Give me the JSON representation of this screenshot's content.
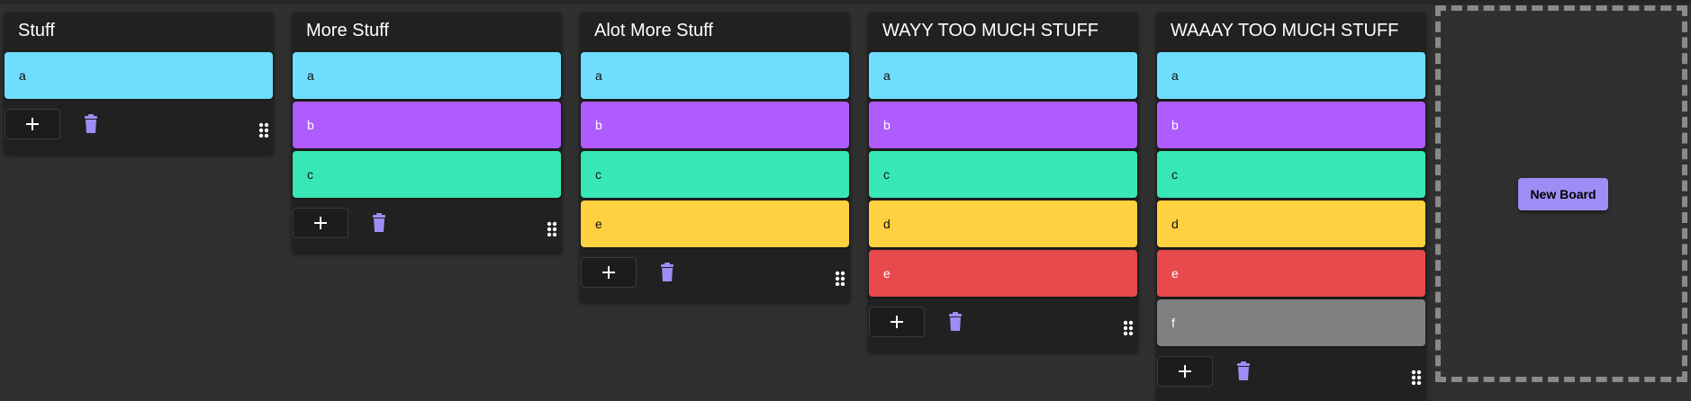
{
  "colors": {
    "background": "#303030",
    "board": "#212121",
    "accent": "#a08cf5",
    "card_colors": {
      "cyan": "#6fdefe",
      "purple": "#ae5cfd",
      "green": "#38e7b6",
      "yellow": "#ffd03f",
      "red": "#e64a4d",
      "gray": "#808080"
    }
  },
  "icons": {
    "add": "plus-icon",
    "delete": "trash-icon",
    "drag": "drag-handle-icon"
  },
  "boards": [
    {
      "title": "Stuff",
      "cards": [
        {
          "label": "a",
          "color": "#6fdefe",
          "text_color": "#111111"
        }
      ]
    },
    {
      "title": "More Stuff",
      "cards": [
        {
          "label": "a",
          "color": "#6fdefe",
          "text_color": "#111111"
        },
        {
          "label": "b",
          "color": "#ae5cfd",
          "text_color": "#ffffff"
        },
        {
          "label": "c",
          "color": "#38e7b6",
          "text_color": "#111111"
        }
      ]
    },
    {
      "title": "Alot More Stuff",
      "cards": [
        {
          "label": "a",
          "color": "#6fdefe",
          "text_color": "#111111"
        },
        {
          "label": "b",
          "color": "#ae5cfd",
          "text_color": "#ffffff"
        },
        {
          "label": "c",
          "color": "#38e7b6",
          "text_color": "#111111"
        },
        {
          "label": "e",
          "color": "#ffd03f",
          "text_color": "#111111"
        }
      ]
    },
    {
      "title": "WAYY TOO MUCH STUFF",
      "cards": [
        {
          "label": "a",
          "color": "#6fdefe",
          "text_color": "#111111"
        },
        {
          "label": "b",
          "color": "#ae5cfd",
          "text_color": "#ffffff"
        },
        {
          "label": "c",
          "color": "#38e7b6",
          "text_color": "#111111"
        },
        {
          "label": "d",
          "color": "#ffd03f",
          "text_color": "#111111"
        },
        {
          "label": "e",
          "color": "#e64a4d",
          "text_color": "#ffffff"
        }
      ]
    },
    {
      "title": "WAAAY TOO MUCH STUFF",
      "cards": [
        {
          "label": "a",
          "color": "#6fdefe",
          "text_color": "#111111"
        },
        {
          "label": "b",
          "color": "#ae5cfd",
          "text_color": "#ffffff"
        },
        {
          "label": "c",
          "color": "#38e7b6",
          "text_color": "#111111"
        },
        {
          "label": "d",
          "color": "#ffd03f",
          "text_color": "#111111"
        },
        {
          "label": "e",
          "color": "#e64a4d",
          "text_color": "#ffffff"
        },
        {
          "label": "f",
          "color": "#808080",
          "text_color": "#ffffff"
        }
      ]
    }
  ],
  "new_board_label": "New Board"
}
